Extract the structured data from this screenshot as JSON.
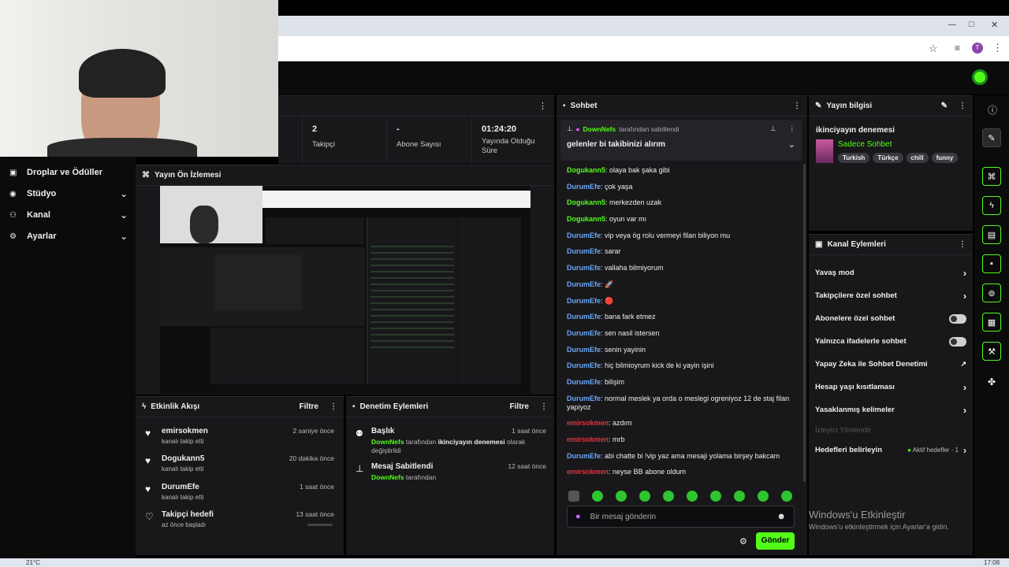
{
  "browser": {
    "buttons": {
      "min": "—",
      "max": "□",
      "close": "✕"
    },
    "avatar_letter": "T"
  },
  "sidebar": {
    "items": [
      {
        "label": "Droplar ve Ödüller",
        "icon": "gift-icon"
      },
      {
        "label": "Stüdyo",
        "icon": "studio-icon"
      },
      {
        "label": "Kanal",
        "icon": "users-icon"
      },
      {
        "label": "Ayarlar",
        "icon": "gear-icon"
      }
    ]
  },
  "stats": [
    {
      "value": "2",
      "label": "Takipçi"
    },
    {
      "value": "-",
      "label": "Abone Sayısı"
    },
    {
      "value": "01:24:20",
      "label": "Yayında Olduğu Süre"
    }
  ],
  "preview": {
    "title": "Yayın Ön İzlemesi"
  },
  "activity": {
    "title": "Etkinlik Akışı",
    "filter": "Filtre",
    "items": [
      {
        "name": "emirsokmen",
        "desc": "kanalı takip etti",
        "time": "2 saniye önce"
      },
      {
        "name": "Dogukann5",
        "desc": "kanalı takip etti",
        "time": "20 dakika önce"
      },
      {
        "name": "DurumEfe",
        "desc": "kanalı takip etti",
        "time": "1 saat önce"
      },
      {
        "name": "Takipçi hedefi",
        "desc": "az önce başladı",
        "time": "13 saat önce"
      }
    ]
  },
  "moderation": {
    "title": "Denetim Eylemleri",
    "filter": "Filtre",
    "items": [
      {
        "title": "Başlık",
        "user": "DownNefs",
        "mid": " tarafından ",
        "bold": "ikinciyayın denemesi",
        "rest": " olarak değiştirildi",
        "time": "1 saat önce"
      },
      {
        "title": "Mesaj Sabitlendi",
        "user": "DownNefs",
        "mid": " tarafından",
        "bold": "",
        "rest": "",
        "time": "12 saat önce"
      }
    ]
  },
  "chat": {
    "title": "Sohbet",
    "pinned": {
      "user": "DownNefs",
      "by": "tarafından sabitlendi",
      "message": "gelenler bi takibinizi alırım"
    },
    "messages": [
      {
        "user": "Dogukann5",
        "color": "green",
        "text": "olaya bak şaka gibi"
      },
      {
        "user": "DurumEfe",
        "color": "blue",
        "text": "çok yaşa"
      },
      {
        "user": "Dogukann5",
        "color": "green",
        "text": "merkezden uzak"
      },
      {
        "user": "Dogukann5",
        "color": "green",
        "text": "oyun var mı"
      },
      {
        "user": "DurumEfe",
        "color": "blue",
        "text": "vip veya ög rolu vermeyi filan biliyon mu"
      },
      {
        "user": "DurumEfe",
        "color": "blue",
        "text": "sarar"
      },
      {
        "user": "DurumEfe",
        "color": "blue",
        "text": "vallaha bilmiyorum"
      },
      {
        "user": "DurumEfe",
        "color": "blue",
        "text": "🚀"
      },
      {
        "user": "DurumEfe",
        "color": "blue",
        "text": "🔴"
      },
      {
        "user": "DurumEfe",
        "color": "blue",
        "text": "bana fark etmez"
      },
      {
        "user": "DurumEfe",
        "color": "blue",
        "text": "sen nasil istersen"
      },
      {
        "user": "DurumEfe",
        "color": "blue",
        "text": "senin yayinin"
      },
      {
        "user": "DurumEfe",
        "color": "blue",
        "text": "hiç bilmioyrum kick de ki yayin işini"
      },
      {
        "user": "DurumEfe",
        "color": "blue",
        "text": "bilişim"
      },
      {
        "user": "DurumEfe",
        "color": "blue",
        "text": "normal meslek ya orda o meslegi ogreniyoz 12 de staj filan yapiyoz"
      },
      {
        "user": "emirsokmen",
        "color": "red",
        "text": "azdım"
      },
      {
        "user": "emirsokmen",
        "color": "red",
        "text": "mrb"
      },
      {
        "user": "DurumEfe",
        "color": "blue",
        "text": "abi chatte bi !vip yaz ama mesaji yolama birşey bakcam"
      },
      {
        "user": "emirsokmen",
        "color": "red",
        "text": "neyse BB abone oldum"
      }
    ],
    "input_placeholder": "Bir mesaj gönderin",
    "send": "Gönder"
  },
  "stream_info": {
    "title": "Yayın bilgisi",
    "stream_title": "ikinciyayın denemesi",
    "category": "Sadece Sohbet",
    "tags": [
      "Turkish",
      "Türkçe",
      "chill",
      "funny"
    ]
  },
  "channel_actions": {
    "title": "Kanal Eylemleri",
    "items": [
      {
        "label": "Yavaş mod",
        "control": "chevron"
      },
      {
        "label": "Takipçilere özel sohbet",
        "control": "chevron"
      },
      {
        "label": "Abonelere özel sohbet",
        "control": "toggle"
      },
      {
        "label": "Yalnızca ifadelerle sohbet",
        "control": "toggle"
      },
      {
        "label": "Yapay Zeka ile Sohbet Denetimi",
        "control": "external"
      },
      {
        "label": "Hesap yaşı kısıtlaması",
        "control": "chevron"
      },
      {
        "label": "Yasaklanmış kelimeler",
        "control": "chevron"
      }
    ],
    "disabled_item": "İzleyici Yönlendir",
    "goals": {
      "label": "Hedefleri belirleyin",
      "status": "Aktif hedefler - 1"
    }
  },
  "watermark": {
    "title": "Windows'u Etkinleştir",
    "subtitle": "Windows'u etkinleştirmek için Ayarlar'a gidin."
  },
  "taskbar": {
    "weather": "21°C",
    "time": "17:08"
  },
  "colors": {
    "accent": "#53fc18",
    "panel": "#18181b",
    "blue_user": "#6aa7f7",
    "red_user": "#e5323f"
  }
}
